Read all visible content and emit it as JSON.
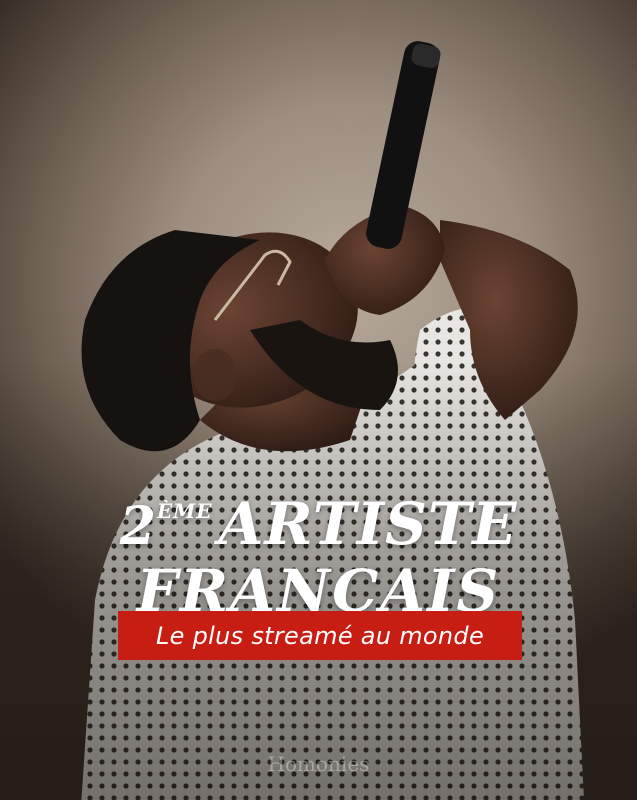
{
  "headline": {
    "number": "2",
    "superscript": "ÈME",
    "word1": "ARTISTE",
    "line2": "FRANÇAIS"
  },
  "banner": {
    "text": "Le plus streamé au monde",
    "color": "#c71d12"
  },
  "watermark": "Homonies"
}
